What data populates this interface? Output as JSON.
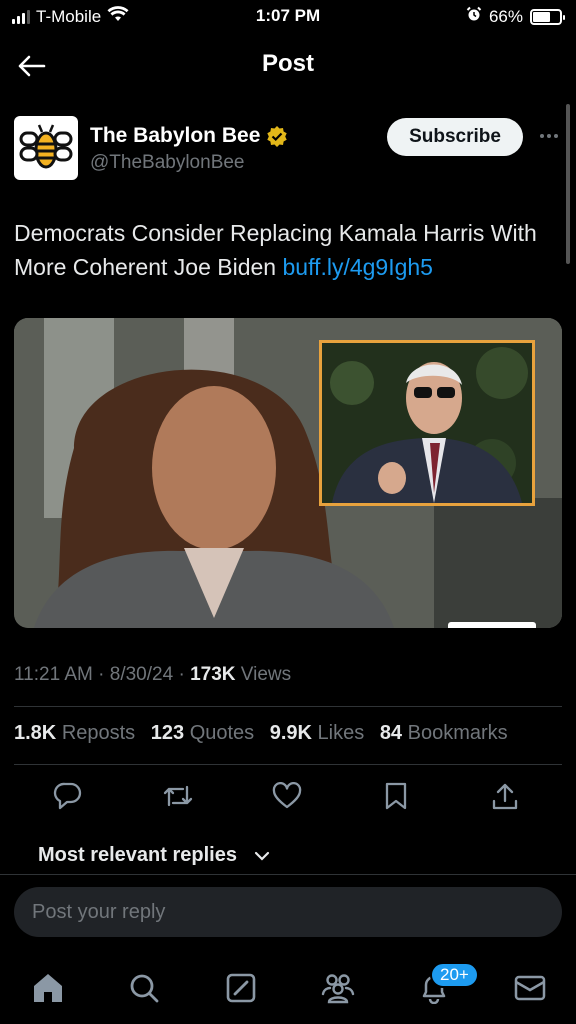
{
  "status_bar": {
    "carrier": "T-Mobile",
    "time": "1:07 PM",
    "battery": "66%",
    "battery_level": 0.66,
    "icons": [
      "signal-icon",
      "wifi-icon",
      "alarm-icon",
      "battery-icon"
    ]
  },
  "header": {
    "title": "Post",
    "back_icon": "arrow-left-icon"
  },
  "post": {
    "author_name": "The Babylon Bee",
    "author_handle": "@TheBabylonBee",
    "verified_icon": "verified-badge-icon",
    "verified_color": "#e2b719",
    "subscribe_label": "Subscribe",
    "more_icon": "more-horizontal-icon",
    "text": "Democrats Consider Replacing Kamala Harris With More Coherent Joe Biden ",
    "link": "buff.ly/4g9Igh5",
    "link_color": "#1d9bf0",
    "timestamp_time": "11:21 AM",
    "timestamp_date": "8/30/24",
    "views_count": "173K",
    "views_label": "Views"
  },
  "stats": [
    {
      "count": "1.8K",
      "label": "Reposts"
    },
    {
      "count": "123",
      "label": "Quotes"
    },
    {
      "count": "9.9K",
      "label": "Likes"
    },
    {
      "count": "84",
      "label": "Bookmarks"
    }
  ],
  "actions": [
    "reply-icon",
    "repost-icon",
    "like-icon",
    "bookmark-icon",
    "share-icon"
  ],
  "replies": {
    "sort_label": "Most relevant replies",
    "reply_placeholder": "Post your reply"
  },
  "tabbar": {
    "items": [
      "home-icon",
      "search-icon",
      "grok-icon",
      "communities-icon",
      "notifications-icon",
      "messages-icon"
    ],
    "notifications_badge": "20+"
  },
  "colors": {
    "background": "#000000",
    "accent": "#1d9bf0",
    "muted_text": "#71767b",
    "divider": "#2f3336"
  }
}
